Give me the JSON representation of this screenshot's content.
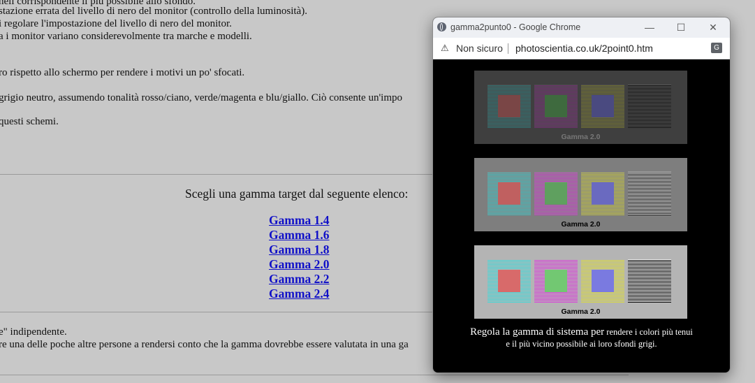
{
  "background": {
    "lines": [
      "nell corrispondente il più possibile allo sfondo.",
      "stazione errata del livello di nero del monitor (controllo della luminosità).",
      "i regolare l'impostazione del livello di nero del monitor.",
      "a i monitor variano considerevolmente tra marche e modelli.",
      "ro rispetto allo schermo per rendere i motivi un po' sfocati.",
      "grigio neutro, assumendo tonalità rosso/ciano, verde/magenta e blu/giallo. Ciò consente un'impo",
      "questi schemi.",
      "e\" indipendente.",
      "re una delle poche altre persone a rendersi conto che la gamma dovrebbe essere valutata in una ga"
    ],
    "heading": "Scegli una gamma target dal seguente elenco:",
    "links": [
      "Gamma 1.4",
      "Gamma 1.6",
      "Gamma 1.8",
      "Gamma 2.0",
      "Gamma 2.2",
      "Gamma 2.4"
    ]
  },
  "popup": {
    "title": "gamma2punto0 - Google Chrome",
    "controls": {
      "minimize": "—",
      "maximize": "☐",
      "close": "✕"
    },
    "security_label": "Non sicuro",
    "url": "photoscientia.co.uk/2point0.htm",
    "panels": [
      {
        "label": "Gamma 2.0",
        "label_color": "#777777",
        "bg": "#3f3f3f"
      },
      {
        "label": "Gamma 2.0",
        "label_color": "#000000",
        "bg": "#7e7e7e"
      },
      {
        "label": "Gamma 2.0",
        "label_color": "#000000",
        "bg": "#b4b4b4"
      }
    ],
    "bottom_text_line1_large": "Regola la gamma di sistema per",
    "bottom_text_line1_small": " rendere i colori più tenui",
    "bottom_text_line2": "e il più vicino possibile ai loro sfondi grigi."
  },
  "colors": {
    "link": "#1010c8",
    "page_bg": "#c8c8c8",
    "popup_bg": "#000000",
    "patterns": [
      "cyan/red",
      "magenta/green",
      "yellow/blue",
      "black/white"
    ]
  }
}
